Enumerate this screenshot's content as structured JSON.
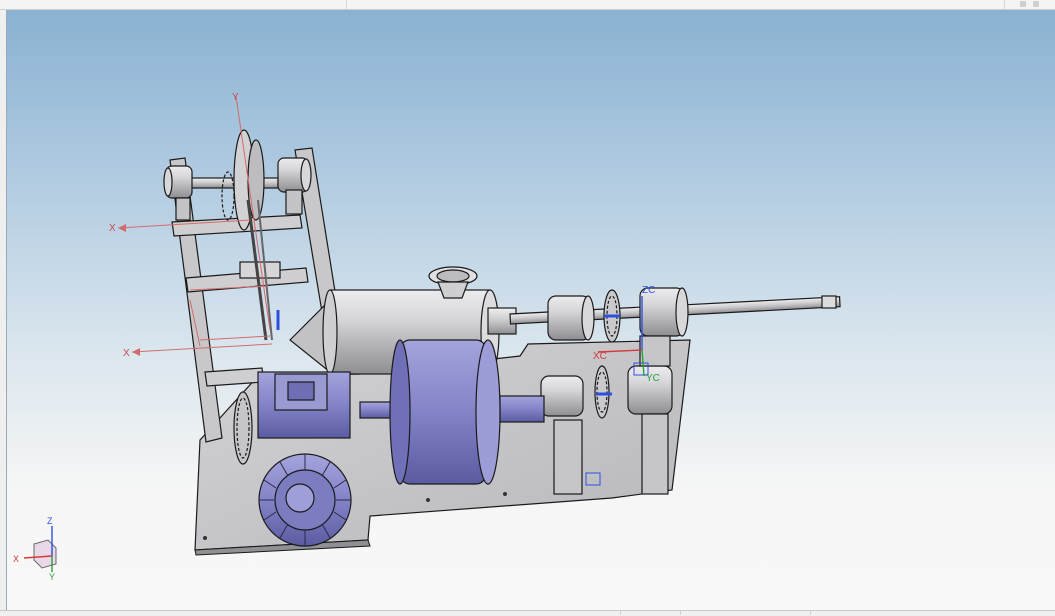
{
  "window": {
    "title": "",
    "colors": {
      "background_top": "#8ab2d2",
      "background_bottom": "#f6f6f6",
      "model_gray": "#c9c9cc",
      "motor_purple": "#8080c4",
      "wcs_blue": "#2b50e0",
      "wcs_red": "#d43a3a",
      "wcs_green": "#29a03a"
    }
  },
  "viewport": {
    "datum_labels": {
      "x_axis_upper": "X",
      "x_axis_lower": "X",
      "y_axis": "Y",
      "zc": "ZC",
      "yc": "YC",
      "xc": "XC"
    },
    "triad": {
      "x": "X",
      "y": "Y",
      "z": "Z"
    },
    "icons": [
      "datum-axis-icon",
      "csys-triad-icon",
      "constraint-marker-icon"
    ]
  }
}
